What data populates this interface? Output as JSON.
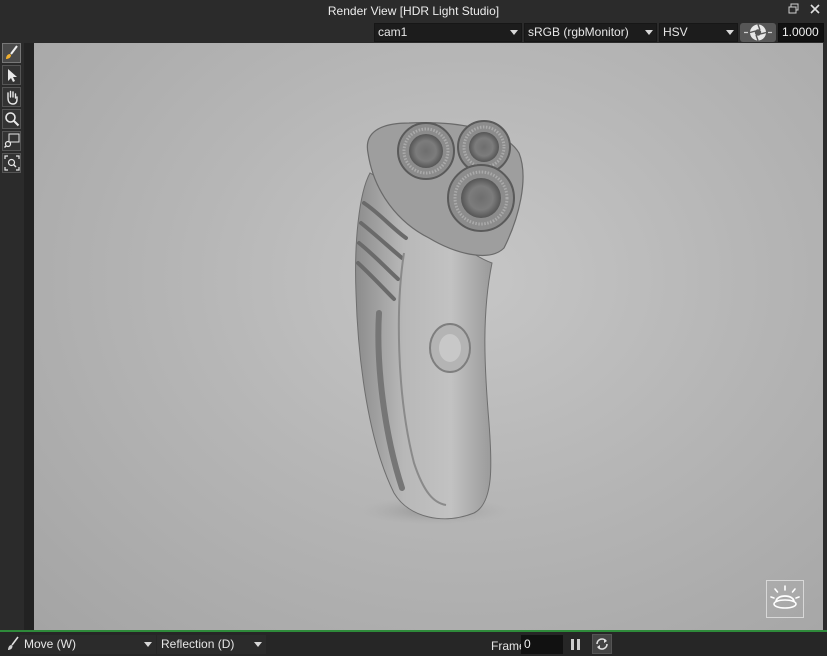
{
  "window": {
    "title": "Render View [HDR Light Studio]"
  },
  "toolbar": {
    "camera": "cam1",
    "color_space": "sRGB (rgbMonitor)",
    "color_mode": "HSV",
    "exposure_value": "1.0000"
  },
  "tools": [
    {
      "name": "paint-tool",
      "icon": "brush-icon"
    },
    {
      "name": "select-tool",
      "icon": "arrow-icon"
    },
    {
      "name": "pan-tool",
      "icon": "hand-icon"
    },
    {
      "name": "zoom-tool",
      "icon": "magnifier-icon"
    },
    {
      "name": "zoom-region-tool",
      "icon": "zoom-region-icon"
    },
    {
      "name": "zoom-fit-tool",
      "icon": "zoom-fit-icon"
    }
  ],
  "status": {
    "mode": "Move (W)",
    "light_type": "Reflection (D)",
    "frame_label": "Frame",
    "frame_value": "0"
  },
  "colors": {
    "accent_line": "#2e8a3a",
    "background": "#2b2b2b"
  }
}
